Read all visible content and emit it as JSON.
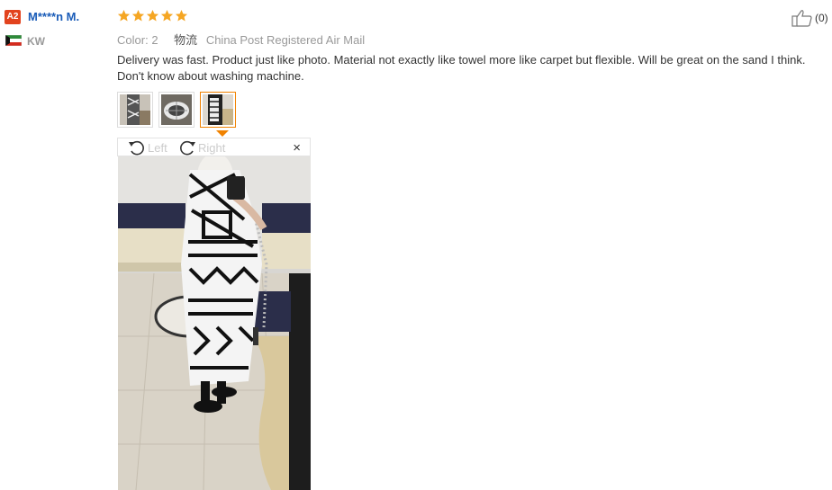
{
  "reviewer": {
    "level_badge": "A2",
    "name": "M****n M.",
    "country": "KW"
  },
  "rating": {
    "stars": 5,
    "max": 5
  },
  "helpful": {
    "count": "(0)"
  },
  "attributes": {
    "color_label": "Color:",
    "color_value": "2",
    "shipping_label": "物流",
    "shipping_value": "China Post Registered Air Mail"
  },
  "review_text": "Delivery was fast. Product just like photo. Material not exactly like towel more like carpet but flexible. Will be great on the sand I think. Don't know about washing machine.",
  "viewer": {
    "rotate_left": "Left",
    "rotate_right": "Right",
    "close": "×"
  },
  "colors": {
    "badge": "#e2431e",
    "username": "#1a5cb8",
    "star": "#f5a623",
    "active_border": "#f08200"
  }
}
